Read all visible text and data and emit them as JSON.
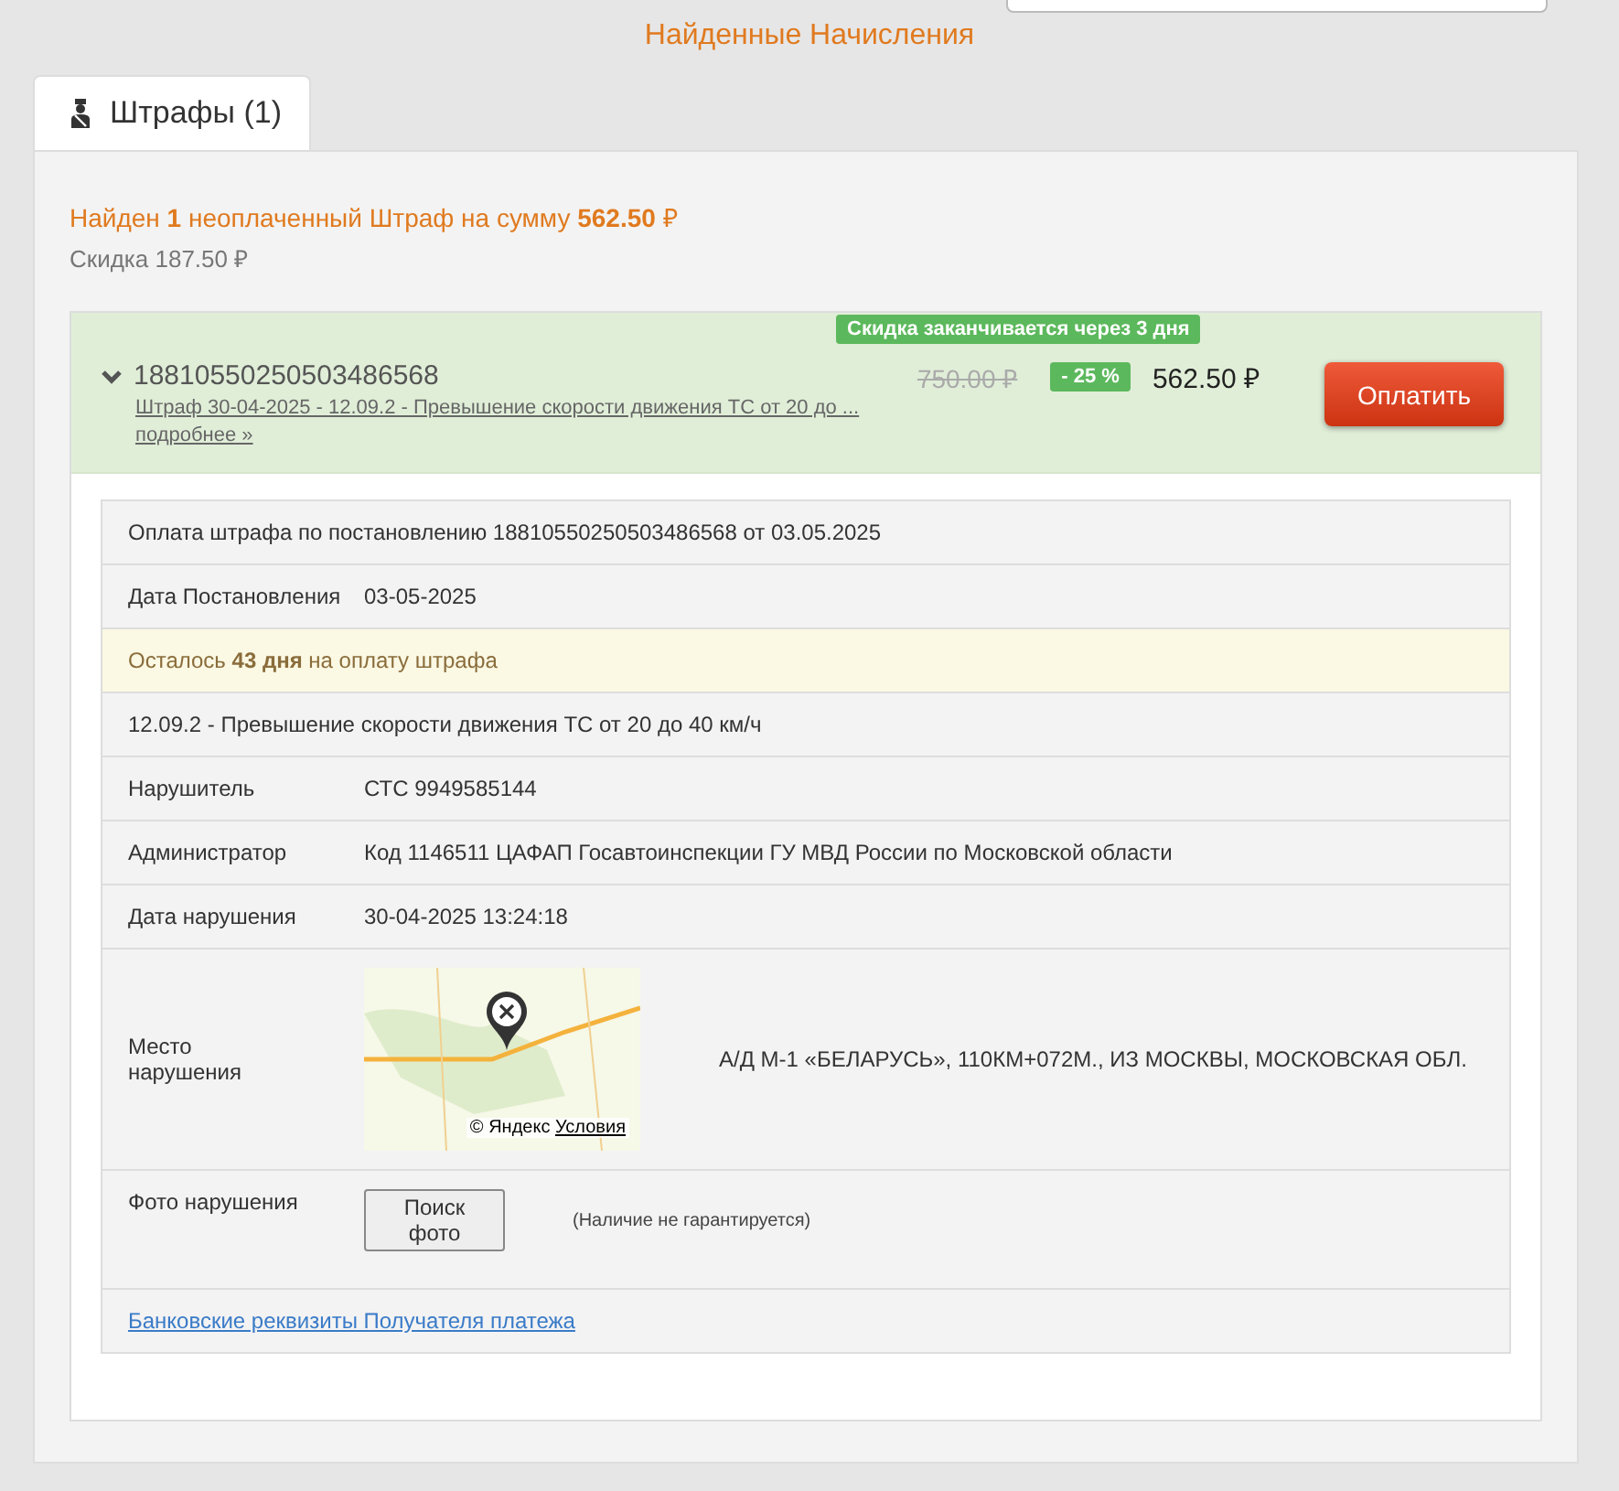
{
  "page_title": "Найденные Начисления",
  "tabs": [
    {
      "label": "Штрафы (1)",
      "selected": true
    }
  ],
  "summary": {
    "text": "Найден **1** неоплаченный Штраф на сумму **562.50** ₽",
    "discount": "Скидка 187.50 ₽"
  },
  "fine": {
    "expanded": true,
    "number": "18810550250503486568",
    "discount_badge": "Скидка заканчивается через 3 дня",
    "description_link": "Штраф 30-04-2025 - 12.09.2 - Превышение скорости движения ТС от 20 до ...",
    "more_link": "подробнее »",
    "old_price": "750.00 ₽",
    "percent_badge": "- 25 %",
    "price": "562.50 ₽",
    "pay_button": "Оплатить"
  },
  "details": {
    "title": "Оплата штрафа по постановлению 18810550250503486568 от 03.05.2025",
    "rows": [
      {
        "kind": "pair",
        "label": "Дата Постановления",
        "value": "03-05-2025"
      },
      {
        "kind": "notice",
        "value": "Осталось **43 дня** на оплату штрафа"
      },
      {
        "kind": "full",
        "value": "12.09.2 - Превышение скорости движения ТС от 20 до 40 км/ч"
      },
      {
        "kind": "pair",
        "label": "Нарушитель",
        "value": "СТС 9949585144"
      },
      {
        "kind": "pair",
        "label": "Администратор",
        "value": "Код 1146511 ЦАФАП Госавтоинспекции ГУ МВД России по Московской области"
      },
      {
        "kind": "pair",
        "label": "Дата нарушения",
        "value": "30-04-2025 13:24:18"
      },
      {
        "kind": "map",
        "label": "Место нарушения",
        "value": "А/Д М-1 «БЕЛАРУСЬ», 110КМ+072М., ИЗ МОСКВЫ, МОСКОВСКАЯ ОБЛ.",
        "map_credit": "© Яндекс",
        "map_terms": "Условия"
      },
      {
        "kind": "photo",
        "label": "Фото нарушения",
        "button": "Поиск фото",
        "note": "(Наличие не гарантируется)"
      }
    ],
    "bank_link": "Банковские реквизиты Получателя платежа"
  }
}
